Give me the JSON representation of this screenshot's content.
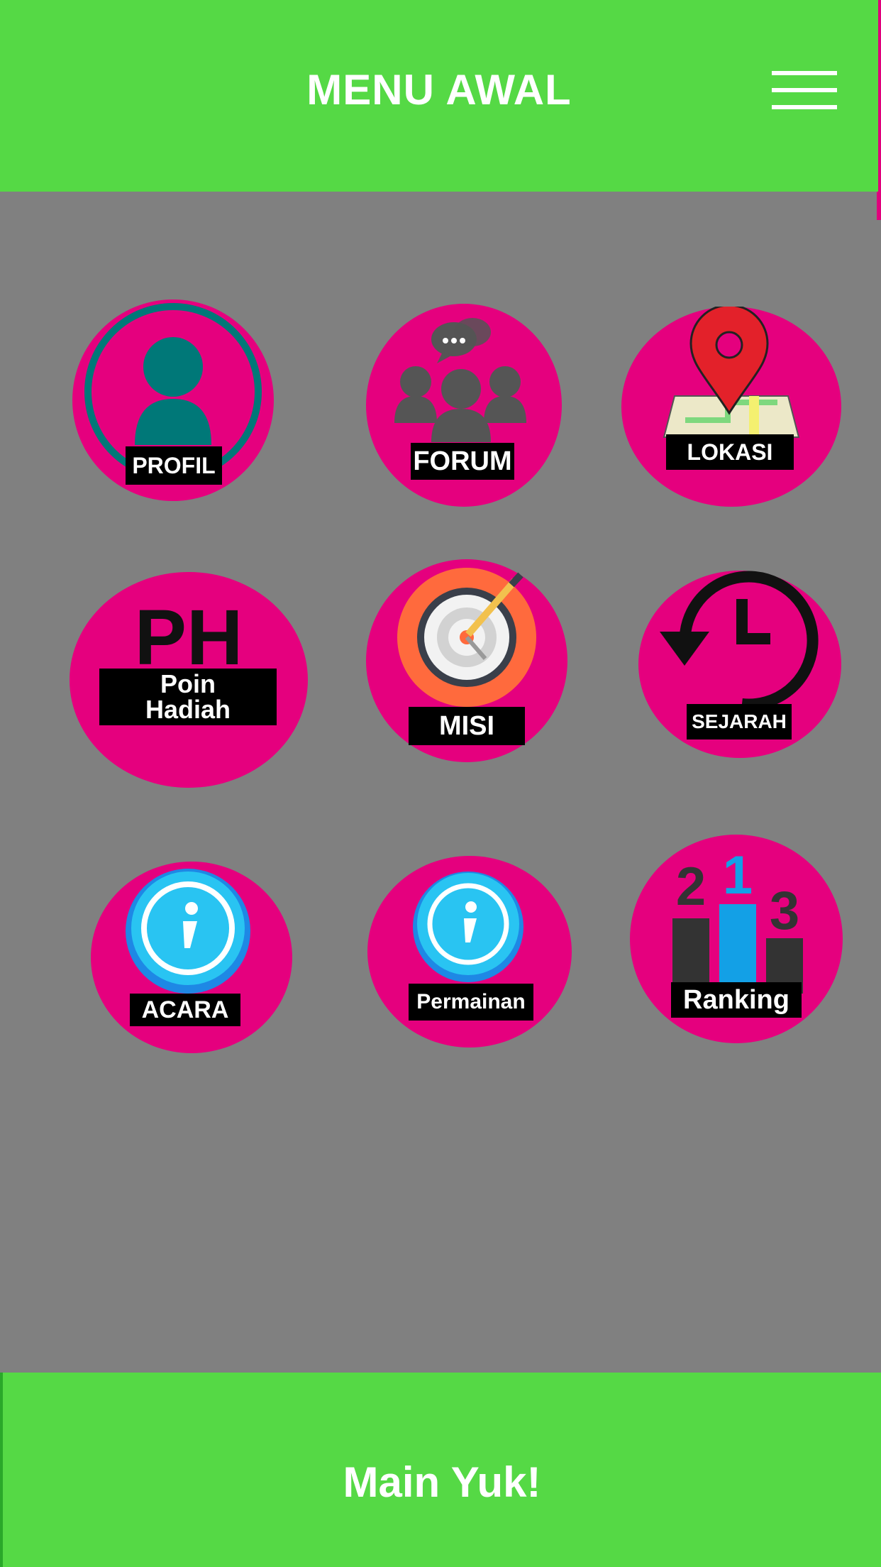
{
  "header": {
    "title": "MENU AWAL",
    "menu_icon": "hamburger-menu-icon"
  },
  "menu": {
    "profil": {
      "label": "PROFIL",
      "icon": "user-profile-icon"
    },
    "forum": {
      "label": "FORUM",
      "icon": "group-chat-icon"
    },
    "lokasi": {
      "label": "LOKASI",
      "icon": "map-pin-icon"
    },
    "poin_hadiah": {
      "letters": "PH",
      "line1": "Poin",
      "line2": "Hadiah"
    },
    "misi": {
      "label": "MISI",
      "icon": "target-icon"
    },
    "sejarah": {
      "label": "SEJARAH",
      "icon": "history-clock-icon"
    },
    "acara": {
      "label": "ACARA",
      "icon": "info-icon"
    },
    "permainan": {
      "label": "Permainan",
      "icon": "info-icon"
    },
    "ranking": {
      "label": "Ranking",
      "first": "1",
      "second": "2",
      "third": "3",
      "icon": "podium-icon"
    }
  },
  "footer": {
    "label": "Main Yuk!"
  },
  "colors": {
    "bar": "#55d945",
    "circle": "#e5007e",
    "background": "#808080"
  }
}
